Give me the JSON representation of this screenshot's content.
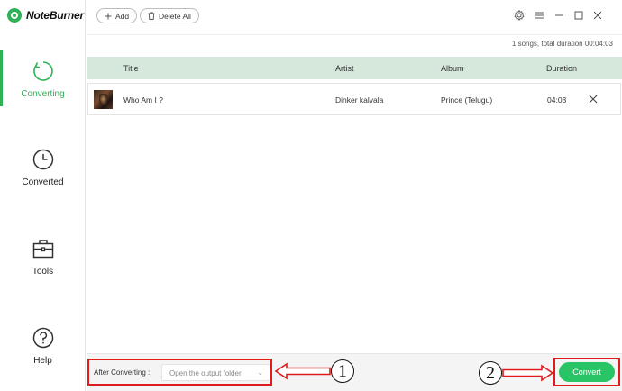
{
  "app": {
    "name": "NoteBurner",
    "brand_color": "#2fb257"
  },
  "sidebar": {
    "items": [
      {
        "label": "Converting",
        "icon": "converting-icon",
        "active": true
      },
      {
        "label": "Converted",
        "icon": "clock-icon",
        "active": false
      },
      {
        "label": "Tools",
        "icon": "toolbox-icon",
        "active": false
      },
      {
        "label": "Help",
        "icon": "help-icon",
        "active": false
      }
    ]
  },
  "toolbar": {
    "add_label": "Add",
    "delete_all_label": "Delete All",
    "window_icons": [
      "settings-icon",
      "menu-icon",
      "minimize-icon",
      "maximize-icon",
      "close-icon"
    ]
  },
  "summary": "1 songs, total duration 00:04:03",
  "table": {
    "columns": [
      "Title",
      "Artist",
      "Album",
      "Duration"
    ],
    "rows": [
      {
        "title": "Who Am I ?",
        "artist": "Dinker kalvala",
        "album": "Prince (Telugu)",
        "duration": "04:03"
      }
    ]
  },
  "bottom": {
    "after_converting_label": "After Converting :",
    "after_converting_value": "Open the output folder",
    "convert_label": "Convert",
    "convert_color": "#29c465"
  },
  "annotations": {
    "step1": "1",
    "step2": "2",
    "highlight_color": "#e01b1b"
  }
}
